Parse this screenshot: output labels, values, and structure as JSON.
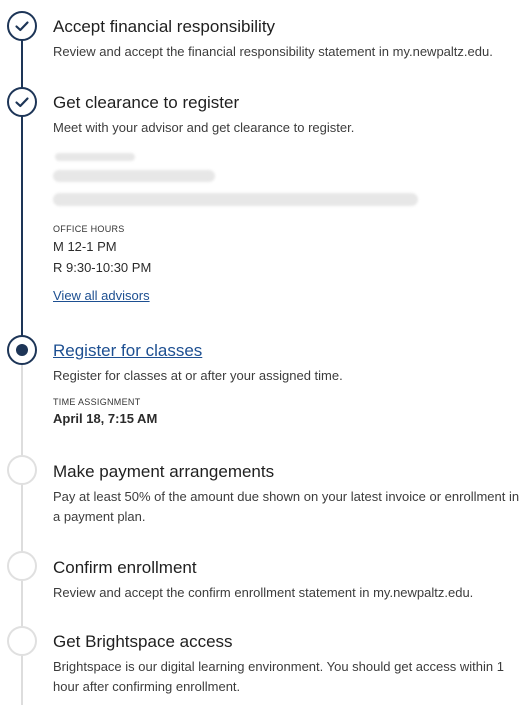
{
  "steps": [
    {
      "title": "Accept financial responsibility",
      "description": "Review and accept the financial responsibility statement in my.newpaltz.edu.",
      "status": "complete"
    },
    {
      "title": "Get clearance to register",
      "description": "Meet with your advisor and get clearance to register.",
      "status": "complete"
    },
    {
      "title": "Register for classes",
      "description": "Register for classes at or after your assigned time.",
      "status": "current"
    },
    {
      "title": "Make payment arrangements",
      "description": "Pay at least 50% of the amount due shown on your latest invoice or enrollment in a payment plan.",
      "status": "pending"
    },
    {
      "title": "Confirm enrollment",
      "description": "Review and accept the confirm enrollment statement in my.newpaltz.edu.",
      "status": "pending"
    },
    {
      "title": "Get Brightspace access",
      "description": "Brightspace is our digital learning environment. You should get access within 1 hour after confirming enrollment.",
      "status": "pending"
    }
  ],
  "advisor": {
    "office_hours_label": "OFFICE HOURS",
    "hours": [
      "M 12-1 PM",
      "R 9:30-10:30 PM"
    ],
    "view_all_label": "View all advisors"
  },
  "registration": {
    "time_assignment_label": "TIME ASSIGNMENT",
    "time_assignment_value": "April 18, 7:15 AM"
  },
  "colors": {
    "complete": "#1d3557",
    "link": "#1d4f91",
    "pending": "#e0e0e0"
  }
}
